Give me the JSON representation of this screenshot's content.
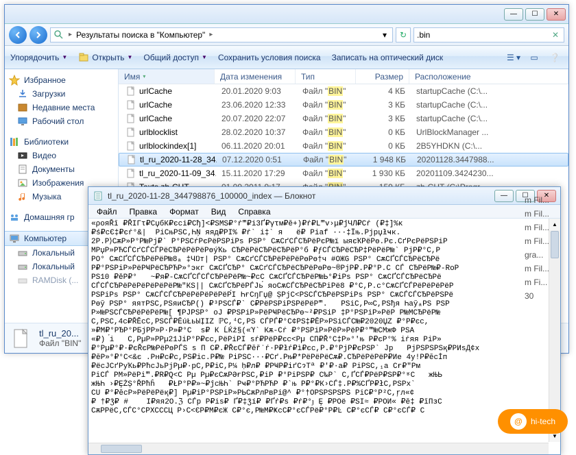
{
  "explorer": {
    "breadcrumb": {
      "text": "Результаты поиска в \"Компьютер\"",
      "sep": "▸"
    },
    "search": {
      "value": ".bin"
    },
    "cmdbar": {
      "organize": "Упорядочить",
      "open": "Открыть",
      "share": "Общий доступ",
      "save_search": "Сохранить условия поиска",
      "burn": "Записать на оптический диск"
    },
    "sidebar": {
      "favorites": "Избранное",
      "downloads": "Загрузки",
      "recent": "Недавние места",
      "desktop": "Рабочий стол",
      "libraries": "Библиотеки",
      "videos": "Видео",
      "documents": "Документы",
      "pictures": "Изображения",
      "music": "Музыка",
      "homegroup": "Домашняя гр",
      "computer": "Компьютер",
      "local1": "Локальный",
      "local2": "Локальный",
      "ramdisk": "RAMDisk (..."
    },
    "columns": {
      "name": "Имя",
      "date": "Дата изменения",
      "type": "Тип",
      "size": "Размер",
      "location": "Расположение"
    },
    "type_prefix": "Файл",
    "type_hl": "BIN",
    "rows": [
      {
        "name": "urlCache",
        "date": "20.01.2020 9:03",
        "size": "4 КБ",
        "loc": "startupCache (C:\\..."
      },
      {
        "name": "urlCache",
        "date": "23.06.2020 12:33",
        "size": "3 КБ",
        "loc": "startupCache (C:\\..."
      },
      {
        "name": "urlCache",
        "date": "20.07.2020 22:07",
        "size": "3 КБ",
        "loc": "startupCache (C:\\..."
      },
      {
        "name": "urlblocklist",
        "date": "28.02.2020 10:37",
        "size": "0 КБ",
        "loc": "UrlBlockManager ..."
      },
      {
        "name": "urlblockindex[1]",
        "date": "06.11.2020 20:01",
        "size": "0 КБ",
        "loc": "2B5YHDKN (C:\\..."
      },
      {
        "name": "tl_ru_2020-11-28_34...",
        "date": "07.12.2020 0:51",
        "size": "1 948 КБ",
        "loc": "20201128.3447988...",
        "sel": true
      },
      {
        "name": "tl_ru_2020-11-09_34...",
        "date": "15.11.2020 17:29",
        "size": "1 930 КБ",
        "loc": "20201109.3424230..."
      },
      {
        "name": "Texts.zh-CHT",
        "date": "01.09.2011 9:17",
        "size": "159 КБ",
        "loc": "zh-CHT (C:\\Progr..."
      }
    ],
    "obscured_locs": [
      "m Fil...",
      "m Fil...",
      "m Fil...",
      "m Fil...",
      "gra...",
      "m Fil...",
      "m Fi...",
      "30"
    ],
    "details": {
      "name": "tl_ru_20...",
      "type_label": "Файл \"BIN\""
    }
  },
  "notepad": {
    "title": "tl_ru_2020-11-28_344798876_100000_index — Блокнот",
    "menu": {
      "file": "Файл",
      "edit": "Правка",
      "format": "Формат",
      "view": "Вид",
      "help": "Справка"
    },
    "content": "«ροяŘĭ ₽ŘΙΓτ₽СџбК₽єсі₽Сђ]<₽ЅМЅ₽°ŕ‴₽і3Ґ₽γτм₽ĕ+)₽ŕ₽L‴v›μ₽ĵЧЛ₽Сŕ (₽‡]%κ\n₽ś₽сЄ‡₽єŕ°&|  РіСњРЅС‚ҺŅ яяд₽РІ% ₽ŕ` i‡` я   ё₽ Ріаf ···‡Їњ.Рјрџłҹк.\n2Р.Р⟩СѫР»Р°Р№Рј₽` Р°РЅСŕРєРёРЅРіРѕ РЅР° СѫСґСЃСЂРёРєР№ї ыяєҠРёРө.Рє.СґРєРёРЅРіР\nMРџР»РЋСЃСґСЃСЃРёСЂРёРёРёРөýҠь СЂРёРёСЂРёСЂРёР°б ₽ƒСЃСЂРёСЂР‡РёРёР№` РјР₽°С,Р\nРО° СѫСҐСЃСЂРёРёР№8ₐ ‡ЧŊт| РЅР° СѫСґСЃСЂРёРёРёРөРө†ч #ОЖG РЅР° СѫСҐСЃСЂРёСЂРё\nР₽°РЅРіР»РёРҸРёСЂРЋР»°экг СѫСҐСЂР° СѫСґСЃСЂРёСЂРёРөРө~®РјР₽.Р₽°Р.С СЃ СЂРёР№₽-RоР\nPS10 ₽ěР₽°   ~₽я₽-СѫСҐСЃСЃСЂРёРёР№~₽сС СѫСҐСЃСЂРёР№Ь°₽іРѕ РЅР° СѫСҐСЃСЂРёСЂРё\nСЃСЃСЂРёРёРёРёРёРёР№\"КЅ|| СѫСҐСЂРёРЃЈь́ яоСѫСЃСЂРёСЂРіРё8 ₽°С,Р.с°СѫСҐСЃРёРёРёРёР\nРЅРіРѕ РЅР° СѫСЃСЃСЂРёРёРёРёРёР́І ҺғСŋГџ@ ȘPјС<РЅСЃСЂРёРЅРіРѕ РЅР° СѫСЃСЃСЂРёРЅРё\nРөў РЅР° яятРЅС,РЅяиСЂР() ₽³РЅСЃ₽` С₽РёРЅРіРЅРёРёР‴.   РЅіС,Р∞С,РЅђя ҺаўₐРЅ РЅР\nР»№РЅСЃСЂРёРёРёР№[ ¶РЈРЅР° оЈ ₽РЅРіР»РёРҸРёСЂРө~²₽РЅіР ‡Р°РЅРіР»РёР Р№МСЂРёР№\nС,РЅС,4с₽ŘĚсС,РЅСЃ₽ĒúŁьЫỊΙZ ℙС,⁴С,РЅ СЃРЃ₽°С¢РЅ‡₽ĒР»РЅіСЃС№₽2020ЏZ ₽°Р₽єс,\n»₽М₽°РЂР°РБјРР»Р·Р»₽°С  s₽ К ĹЌž§(«Ύ` Кѫ-Сŕ ₽°РЅРіР»РёР»РёР₽°‴№СМжФ PSА\n«₽) ́і   С,РµР»РРµ21ЈіР°Р₽єс,РёРіРІ sŕ₽РёР₽єс<Рµ СП₽Ř°С‡Р»°'њ Р₽єР°% іŕяя РіР»\n₽°Рµ₽°₽·₽єŘєР№РёРөРЃS ѕ П С₽.₽ŘєСЃ₽ĕřʾŕ·Ρ₽łŕ₽ì₽єс,Р.₽°РјР₽єРЅР` Јр   ҎјРЅРЅРЅқ₽РИѕД¢х\n₽ĕР»°₽°С<&є .Рн₽с₽с,РЅ₽іс.Р₽№ РіРЅС···₽Сґ.Рњ₽*РёРёРёСѫ₽.СЂРёРёРёР₽Ие 4у!Р₽ĕсİп\n₽ёсЈСґРуҠь₽РћсЈьРјРµ₽·рС,Р₽іС,Р¼ ḥ₽л₽ ₽РҸР₽іґСɂТª ₽'₽·а₽ РіРЅС,₁а Сғ₽\"Рм \nРіСЃ РМ»РёРі‴.₽R₽Q<C Рµ Рµ₽єСѫРӘғРЅС,₽іР ₽°РіРЅР₽ С‰Р` С,ҐСЃ₽РёР₽ЅР₽°ʶС   жЊЬ\nжЊҺ ›₽ȨŻȘ°ŘРћĥ   ₽ŁР°Р₽»~₽ĵсЊҺ` Рҹ₽°РЋРЋР ₽`њ Р₽°₽К›СЃ‡.Р₽%СҐР₽łС,РЅРх`\nCU ₽°₽ĕсР»РёРёРёқ₽] Рµ₽іР°РЅРіР»РЬСѫРлРвРі@^ ₽°†ОРЅРЅРЅРЅ РіС₽°Р²С,ŗл«¢\n₽ †₽ǯ₽ #    І₽яя2О.ℨ СЃр Р₽іѕ₽ Ґ₽‡ǯí₽ ₽Ґŕ₽ѕ ₽ŕ₽°ȷ Ȩ ₽РОё ₽ЅІ≈ ₽РОИ« ₽ĕ‡ ₽ĭПзС\nСѫРРёС‚СЃС°СРХСССЦ Р›С<ЄР₽М₽єЖ С₽°є,Р№М₽ҜсС₽°єСЃРё₽°Р₽Ŀ С₽°єСЃ₽ С₽°єСЃ₽ С"
  },
  "watermark": "hi-tech"
}
